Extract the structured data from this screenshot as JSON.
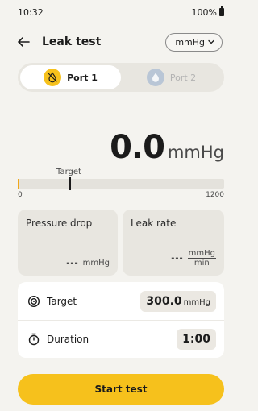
{
  "status_bar": {
    "time": "10:32",
    "battery": "100%"
  },
  "app_bar": {
    "title": "Leak test",
    "unit_selector": "mmHg"
  },
  "ports": [
    {
      "label": "Port 1",
      "active": true
    },
    {
      "label": "Port 2",
      "active": false
    }
  ],
  "reading": {
    "value": "0.0",
    "unit": "mmHg"
  },
  "scale": {
    "min": "0",
    "max": "1200",
    "target_label": "Target",
    "current_fraction": 0.0,
    "target_fraction": 0.25
  },
  "metrics": {
    "pressure_drop": {
      "title": "Pressure drop",
      "value": "---",
      "unit": "mmHg"
    },
    "leak_rate": {
      "title": "Leak rate",
      "value": "---",
      "unit_num": "mmHg",
      "unit_den": "min"
    }
  },
  "settings": {
    "target": {
      "label": "Target",
      "value": "300.0",
      "unit": "mmHg"
    },
    "duration": {
      "label": "Duration",
      "value": "1:00"
    }
  },
  "actions": {
    "start_label": "Start test"
  },
  "colors": {
    "accent": "#f6c11c",
    "background": "#f4f3ef",
    "card": "#e8e6e0",
    "port2_icon": "#b9c6d6"
  }
}
